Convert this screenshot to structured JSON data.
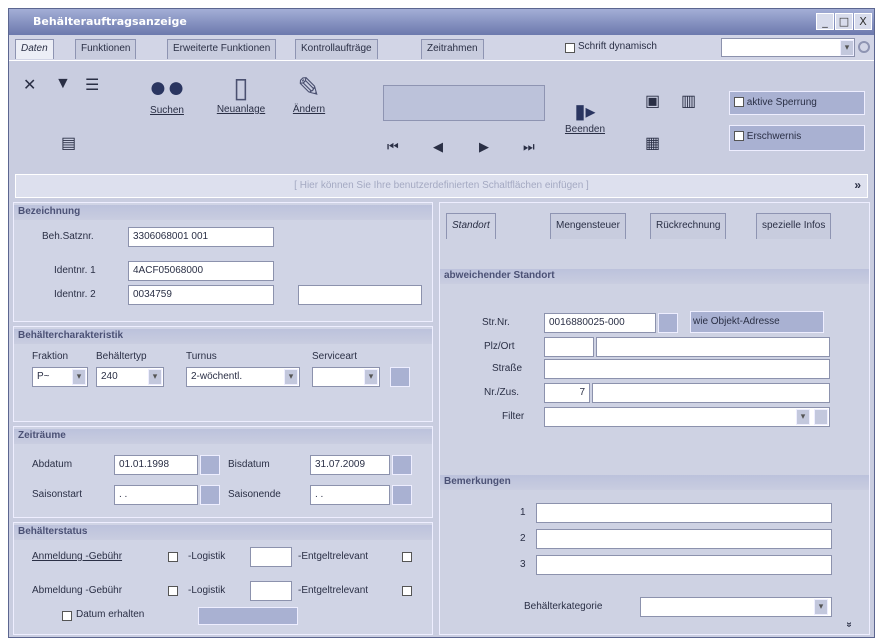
{
  "window": {
    "title": "Behälterauftragsanzeige",
    "min": "_",
    "max": "□",
    "close": "X"
  },
  "tabs": [
    "Daten",
    "Funktionen",
    "Erweiterte Funktionen",
    "Kontrollaufträge",
    "Zeitrahmen"
  ],
  "schrift_dyn": "Schrift dynamisch",
  "toolbar": {
    "suchen": "Suchen",
    "neuanlage": "Neuanlage",
    "aendern": "Ändern",
    "beenden": "Beenden",
    "aktive_sperrung": "aktive Sperrung",
    "erschwernis": "Erschwernis"
  },
  "hint": "[ Hier können Sie Ihre benutzerdefinierten Schaltflächen einfügen ]",
  "hint_arrow": "»",
  "left": {
    "bezeichnung": "Bezeichnung",
    "beh_satznr_label": "Beh.Satznr.",
    "beh_satznr": "3306068001   001",
    "ident1_label": "Identnr. 1",
    "ident1": "4ACF05068000",
    "ident2_label": "Identnr. 2",
    "ident2": "0034759",
    "ident3": "",
    "charakteristik": "Behältercharakteristik",
    "fraktion_label": "Fraktion",
    "fraktion": "P~",
    "typ_label": "Behältertyp",
    "typ": "240",
    "turnus_label": "Turnus",
    "turnus": "2-wöchentl.",
    "service_label": "Serviceart",
    "service": "",
    "zeitraeume": "Zeiträume",
    "abdatum_label": "Abdatum",
    "abdatum": "01.01.1998",
    "bisdatum_label": "Bisdatum",
    "bisdatum": "31.07.2009",
    "saisonstart_label": "Saisonstart",
    "saisonstart": ". .",
    "saisonende_label": "Saisonende",
    "saisonende": ". .",
    "status": "Behälterstatus",
    "anmeldung": "Anmeldung -Gebühr",
    "abmeldung": "Abmeldung -Gebühr",
    "logistik": "-Logistik",
    "entgelt": "-Entgeltrelevant",
    "datum_erhalten": "Datum erhalten"
  },
  "right": {
    "tabs": [
      "Standort",
      "Mengensteuer",
      "Rückrechnung",
      "spezielle Infos"
    ],
    "standort": "abweichender Standort",
    "strnr_label": "Str.Nr.",
    "strnr": "0016880025-000",
    "objekt_btn": "wie Objekt-Adresse",
    "plzort_label": "Plz/Ort",
    "plz": "",
    "ort": "",
    "strasse_label": "Straße",
    "strasse": "",
    "nrzus_label": "Nr./Zus.",
    "nr": "7",
    "zus": "",
    "filter_label": "Filter",
    "filter": "",
    "bemerkungen": "Bemerkungen",
    "b1": "1",
    "b2": "2",
    "b3": "3",
    "kategorie_label": "Behälterkategorie",
    "kategorie": "",
    "more": "»"
  }
}
